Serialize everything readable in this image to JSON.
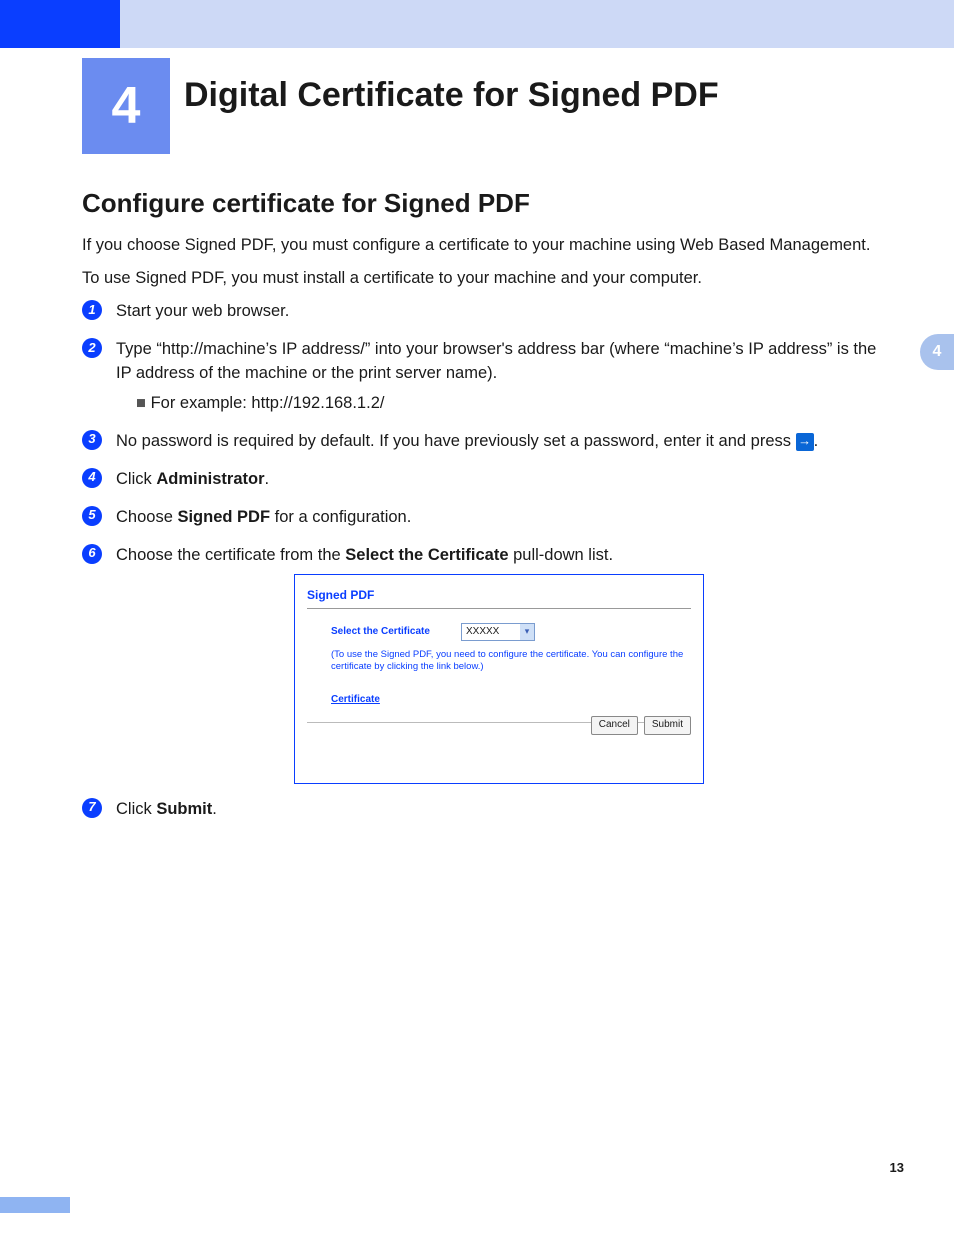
{
  "chapter": {
    "number": "4",
    "title": "Digital Certificate for Signed PDF"
  },
  "section_title": "Configure certificate for Signed PDF",
  "intro1": "If you choose Signed PDF, you must configure a certificate to your machine using Web Based Management.",
  "intro2": "To use Signed PDF, you must install a certificate to your machine and your computer.",
  "steps": {
    "s1": "Start your web browser.",
    "s2": "Type “http://machine’s IP address/” into your browser's address bar (where “machine’s IP address” is the IP address of the machine or the print server name).",
    "s2_example": "For example: http://192.168.1.2/",
    "s3": "No password is required by default. If you have previously set a password, enter it and press ",
    "s4_prefix": "Click ",
    "s4_bold": "Administrator",
    "s5_prefix": "Choose ",
    "s5_bold": "Signed PDF",
    "s5_suffix": " for a configuration.",
    "s6_prefix": "Choose the certificate from the ",
    "s6_bold": "Select the Certificate",
    "s6_suffix": " pull-down list.",
    "s7_prefix": "Click ",
    "s7_bold": "Submit"
  },
  "panel": {
    "title": "Signed PDF",
    "select_label": "Select the Certificate",
    "select_value": "XXXXX",
    "note": "(To use the Signed PDF, you need to configure the certificate. You can configure the certificate by clicking the link below.)",
    "link": "Certificate",
    "cancel": "Cancel",
    "submit": "Submit"
  },
  "side_tab": "4",
  "page_number": "13"
}
